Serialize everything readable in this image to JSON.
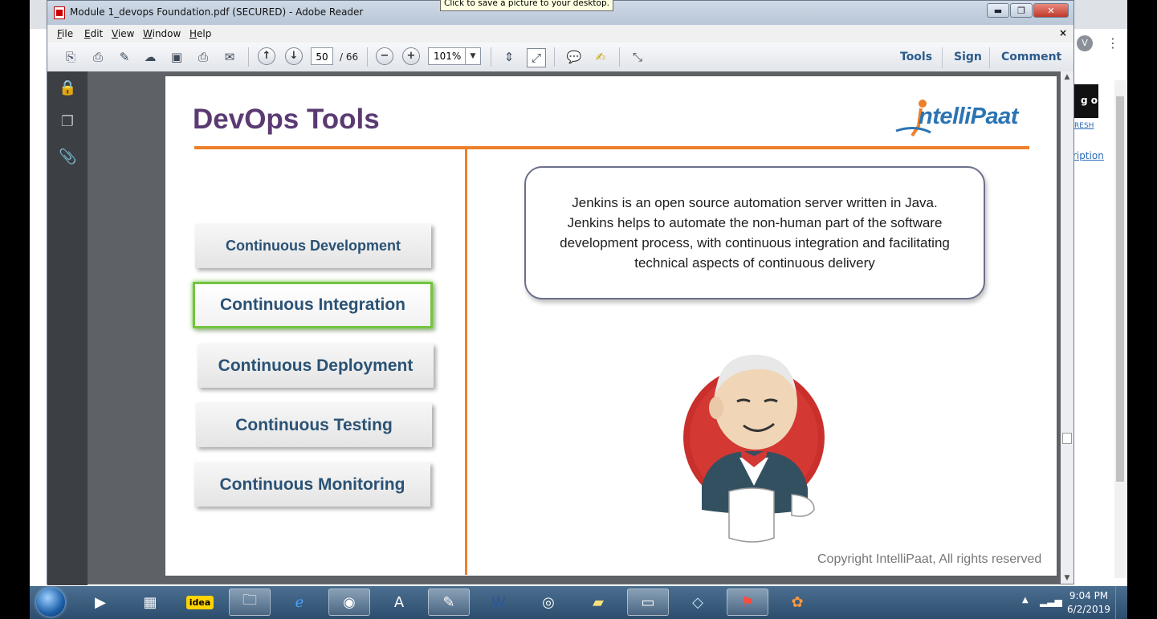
{
  "window": {
    "title": "Module 1_devops Foundation.pdf (SECURED) - Adobe Reader",
    "minimize": "▬",
    "maximize": "❐",
    "close": "✕",
    "tooltip": "Click to save a picture to your desktop."
  },
  "menu": {
    "file": "ile",
    "file_key": "F",
    "edit": "dit",
    "edit_key": "E",
    "view": "iew",
    "view_key": "V",
    "window": "indow",
    "window_key": "W",
    "help": "elp",
    "help_key": "H",
    "close_doc": "×"
  },
  "toolbar": {
    "page_number": "50",
    "page_total": "/ 66",
    "zoom": "101%",
    "tools": "Tools",
    "sign": "Sign",
    "comment": "Comment"
  },
  "slide": {
    "title": "DevOps Tools",
    "logo": "ntelliPaat",
    "stages": [
      {
        "label": "Continuous Development",
        "active": false
      },
      {
        "label": "Continuous Integration",
        "active": true
      },
      {
        "label": "Continuous Deployment",
        "active": false
      },
      {
        "label": "Continuous Testing",
        "active": false
      },
      {
        "label": "Continuous Monitoring",
        "active": false
      }
    ],
    "description": "Jenkins is an open source automation server written in Java. Jenkins helps to automate the non-human part of the software development process, with continuous integration and facilitating technical aspects of continuous delivery",
    "copyright": "Copyright IntelliPaat, All rights reserved"
  },
  "background": {
    "avatar_letter": "V",
    "logout": "g out",
    "refresh": "RESH",
    "description_link": "ription"
  },
  "taskbar": {
    "time": "9:04 PM",
    "date": "6/2/2019"
  },
  "colors": {
    "accent_orange": "#ee7f2a",
    "title_purple": "#5b3a72",
    "active_green": "#73c441",
    "stage_text": "#2a5275"
  }
}
